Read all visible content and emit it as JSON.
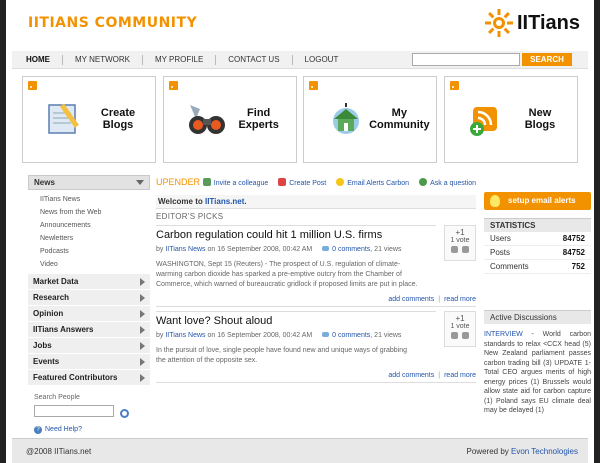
{
  "header": {
    "site_logo": "IITIANS COMMUNITY",
    "brand": "IITians"
  },
  "nav": {
    "items": [
      "HOME",
      "MY NETWORK",
      "MY PROFILE",
      "CONTACT US",
      "LOGOUT"
    ],
    "search_button": "SEARCH"
  },
  "features": [
    {
      "line1": "Create",
      "line2": "Blogs",
      "icon": "notepad-pencil-icon"
    },
    {
      "line1": "Find",
      "line2": "Experts",
      "icon": "binoculars-icon"
    },
    {
      "line1": "My",
      "line2": "Community",
      "icon": "community-house-icon"
    },
    {
      "line1": "New",
      "line2": "Blogs",
      "icon": "rss-add-icon"
    }
  ],
  "sidebar": {
    "news_head": "News",
    "news_sub": [
      "IITians News",
      "News from the Web",
      "Announcements",
      "Newletters",
      "Podcasts",
      "Video"
    ],
    "sections": [
      "Market Data",
      "Research",
      "Opinion",
      "IITians Answers",
      "Jobs",
      "Events",
      "Featured Contributors"
    ],
    "search_label": "Search People",
    "help": "Need Help?"
  },
  "center": {
    "upender": "UPENDER",
    "links": [
      "Invite a colleague",
      "Create Post",
      "Email Alerts Carbon",
      "Ask a question"
    ],
    "welcome_prefix": "Welcome to ",
    "welcome_site": "IITians.net.",
    "picks": "EDITOR'S PICKS",
    "articles": [
      {
        "title": "Carbon regulation could hit 1 million U.S. firms",
        "by": "by",
        "source": "IITians News",
        "date": "on 16 September 2008, 00:42 AM",
        "comments": "0 comments",
        "views": ", 21 views",
        "body": "WASHINGTON, Sept 15 (Reuters) - The prospect of U.S. regulation of climate-warming carbon dioxide has sparked a pre-emptive outcry from the Chamber of Commerce, which warned of bureaucratic gridlock if proposed limits are put in place.",
        "vote_count": "+1",
        "vote_label": "1 vote",
        "add": "add comments",
        "more": "read more"
      },
      {
        "title": "Want love? Shout aloud",
        "by": "by",
        "source": "IITians News",
        "date": "on 16 September 2008, 00:42 AM",
        "comments": "0 comments",
        "views": ", 21 views",
        "body": "In the pursuit of love, single people have found new and unique ways of grabbing the attention of the opposite sex.",
        "vote_count": "+1",
        "vote_label": "1 vote",
        "add": "add comments",
        "more": "read more"
      }
    ]
  },
  "right": {
    "setup": "setup email alerts",
    "stats_head": "STATISTICS",
    "stats": [
      {
        "label": "Users",
        "value": "84752"
      },
      {
        "label": "Posts",
        "value": "84752"
      },
      {
        "label": "Comments",
        "value": "752"
      }
    ],
    "disc_head": "Active Discussions",
    "disc_tag": "INTERVIEW",
    "disc_text": " - World carbon standards to relax <CCX head (5) New Zealand parliament passes carbon trading bill (3) UPDATE 1-Total CEO argues merits of high energy prices (1) Brussels would allow state aid for carbon capture (1) Poland says EU climate deal may be delayed (1)"
  },
  "footer": {
    "copyright": "@2008 IITians.net",
    "powered": "Powered by ",
    "powered_link": "Evon Technologies"
  },
  "colors": {
    "accent": "#f39200",
    "link": "#2255aa"
  }
}
